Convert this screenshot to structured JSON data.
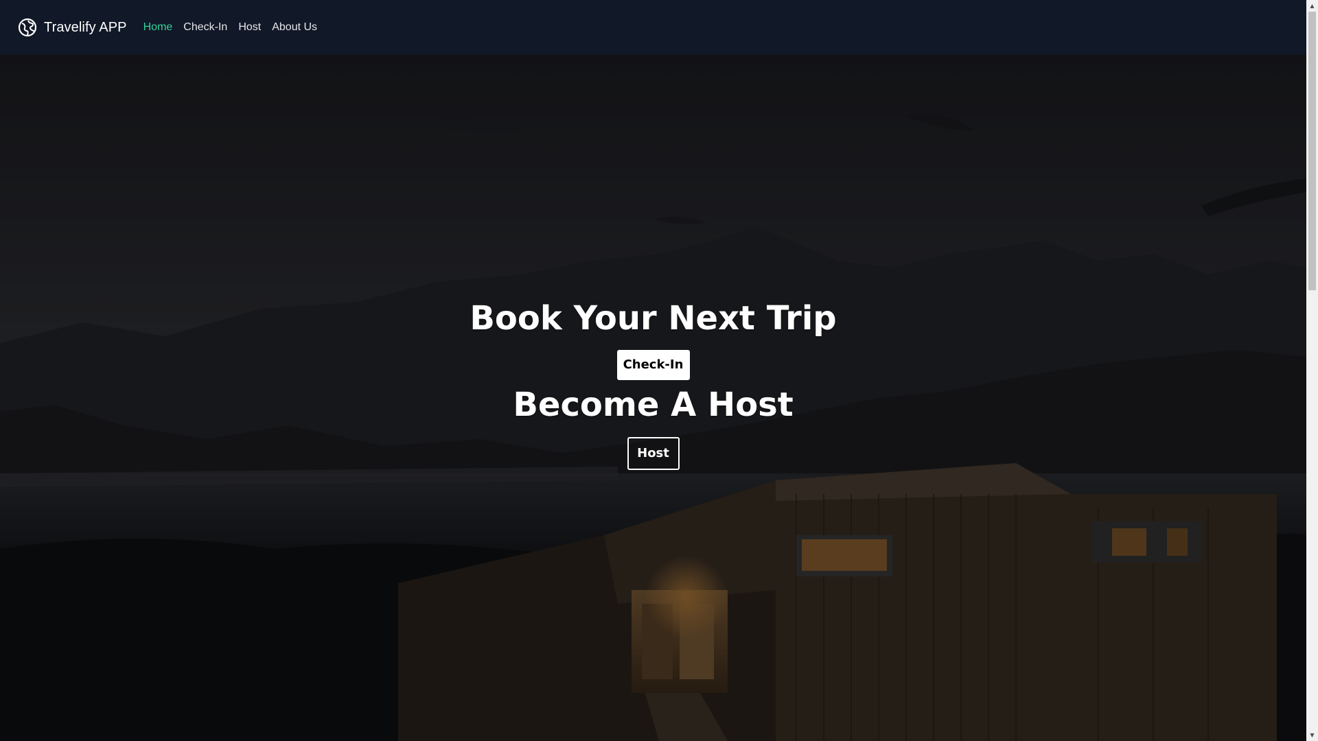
{
  "navbar": {
    "brand_name": "Travelify APP",
    "brand_icon": "globe-icon",
    "links": [
      {
        "label": "Home",
        "active": true
      },
      {
        "label": "Check-In",
        "active": false
      },
      {
        "label": "Host",
        "active": false
      },
      {
        "label": "About Us",
        "active": false
      }
    ]
  },
  "hero": {
    "heading_trip": "Book Your Next Trip",
    "checkin_button": "Check-In",
    "heading_host": "Become A Host",
    "host_button": "Host",
    "background": "night landscape with mountains, lake and lit wooden cabin"
  },
  "colors": {
    "navbar_bg": "#111827",
    "active_link": "#34d399",
    "link": "#e5e7eb",
    "text_white": "#ffffff"
  }
}
